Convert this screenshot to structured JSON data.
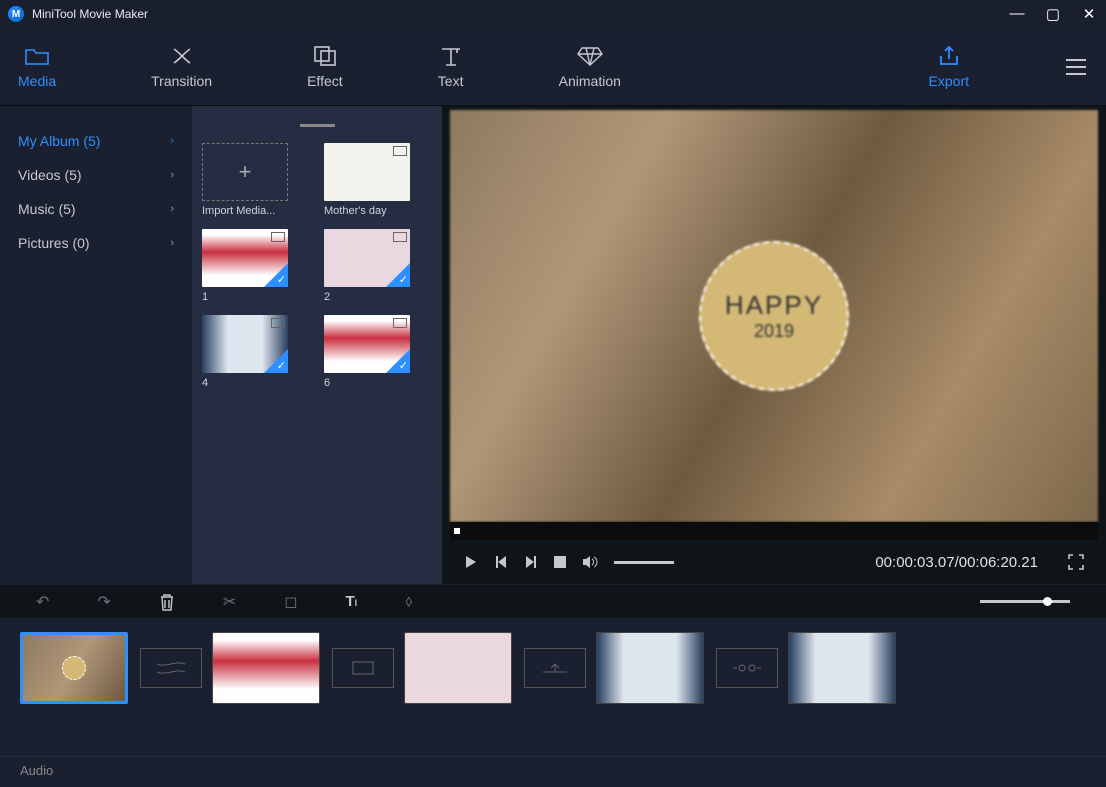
{
  "app": {
    "title": "MiniTool Movie Maker"
  },
  "toolbar": {
    "media": "Media",
    "transition": "Transition",
    "effect": "Effect",
    "text": "Text",
    "animation": "Animation",
    "export": "Export"
  },
  "sidebar": {
    "items": [
      {
        "label": "My Album (5)",
        "active": true
      },
      {
        "label": "Videos (5)"
      },
      {
        "label": "Music (5)"
      },
      {
        "label": "Pictures (0)"
      }
    ]
  },
  "media": {
    "import": "Import Media...",
    "items": [
      {
        "label": "Mother's day"
      },
      {
        "label": "1"
      },
      {
        "label": "2"
      },
      {
        "label": "4"
      },
      {
        "label": "6"
      }
    ]
  },
  "preview": {
    "circle_t1": "HAPPY",
    "circle_t2": "2019",
    "timecode": "00:00:03.07/00:06:20.21"
  },
  "timeline": {
    "audio": "Audio"
  }
}
